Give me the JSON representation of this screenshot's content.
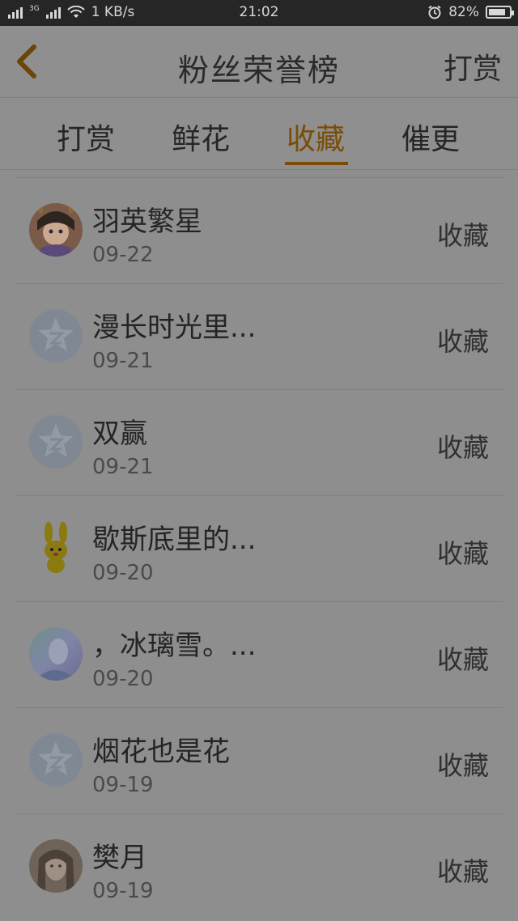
{
  "status_bar": {
    "network_speed": "1 KB/s",
    "time": "21:02",
    "battery": "82%",
    "battery_level": 0.82,
    "network_type": "3G"
  },
  "header": {
    "title": "粉丝荣誉榜",
    "right_action": "打赏",
    "back_icon": "chevron-left-icon",
    "accent_color": "#7a4d05"
  },
  "tabs": [
    {
      "label": "打赏",
      "active": false
    },
    {
      "label": "鲜花",
      "active": false
    },
    {
      "label": "收藏",
      "active": true
    },
    {
      "label": "催更",
      "active": false
    }
  ],
  "list": [
    {
      "name": "羽英繁星",
      "date": "09-22",
      "action": "收藏",
      "avatar": "anime-girl-avatar"
    },
    {
      "name": "漫长时光里...",
      "date": "09-21",
      "action": "收藏",
      "avatar": "default-qq-avatar"
    },
    {
      "name": "双赢",
      "date": "09-21",
      "action": "收藏",
      "avatar": "default-qq-avatar"
    },
    {
      "name": "歇斯底里的...",
      "date": "09-20",
      "action": "收藏",
      "avatar": "yellow-bunny-avatar"
    },
    {
      "name": "，冰璃雪。...",
      "date": "09-20",
      "action": "收藏",
      "avatar": "blue-illustration-avatar"
    },
    {
      "name": "烟花也是花",
      "date": "09-19",
      "action": "收藏",
      "avatar": "default-qq-avatar"
    },
    {
      "name": "樊月",
      "date": "09-19",
      "action": "收藏",
      "avatar": "portrait-avatar"
    }
  ]
}
